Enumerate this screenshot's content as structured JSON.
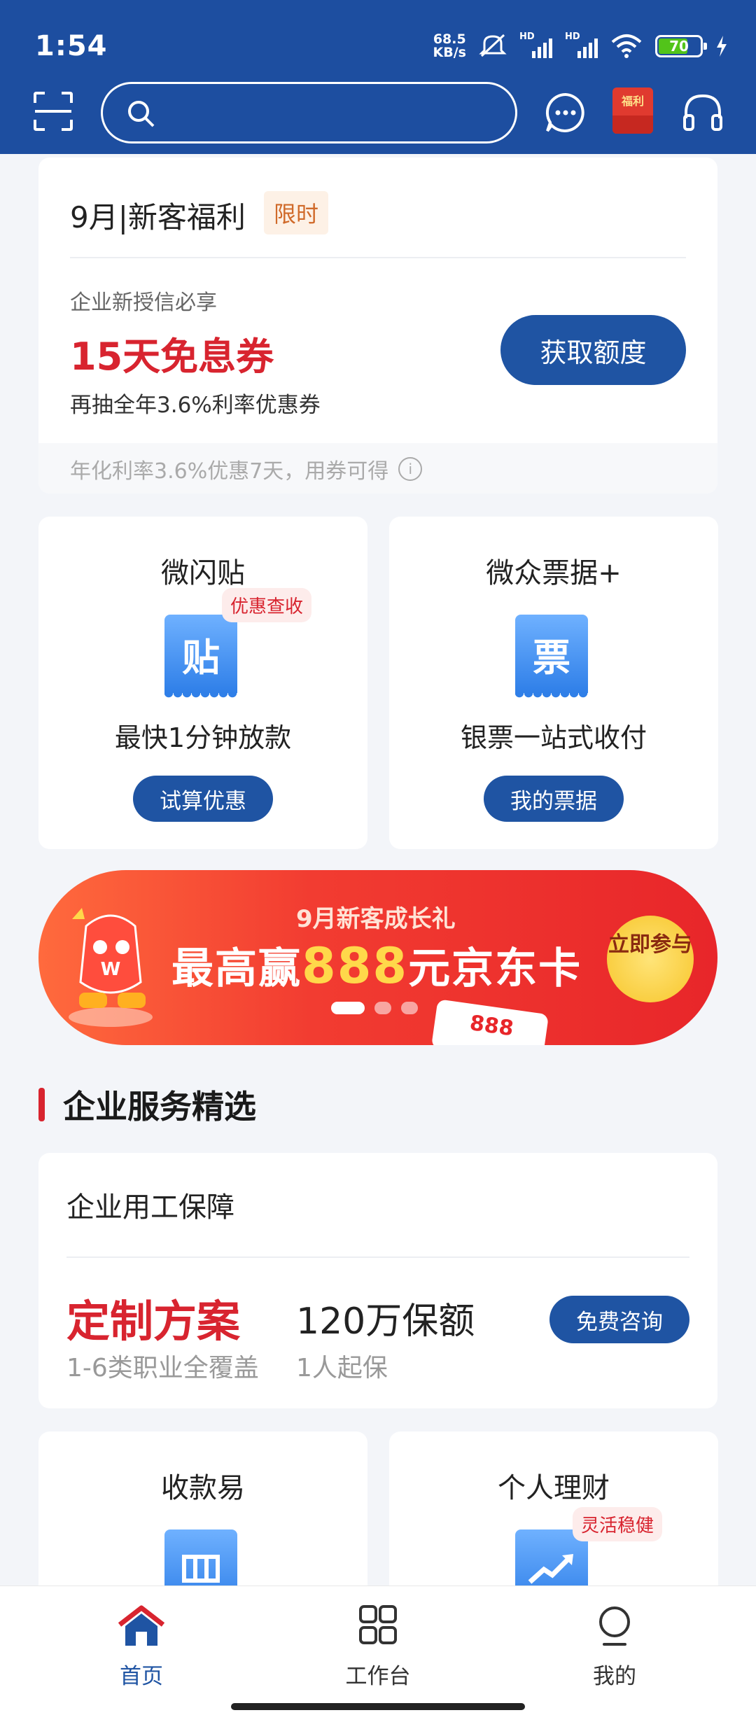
{
  "status": {
    "time": "1:54",
    "net_speed_value": "68.5",
    "net_speed_unit": "KB/s",
    "battery": "70",
    "signal_hd": "HD"
  },
  "colors": {
    "header": "#1d4ea0",
    "primary_button": "#1f54a3",
    "accent_red": "#d8242f",
    "background": "#f3f5f9"
  },
  "header": {
    "search_placeholder": "",
    "gift_label": "福利",
    "icons": [
      "scan-icon",
      "search-icon",
      "message-icon",
      "gift-envelope-icon",
      "headset-icon"
    ]
  },
  "welfare": {
    "title": "9月|新客福利",
    "tag": "限时",
    "subtitle": "企业新授信必享",
    "highlight": "15天免息券",
    "description": "再抽全年3.6%利率优惠券",
    "button": "获取额度",
    "footer": "年化利率3.6%优惠7天，用券可得"
  },
  "products_row1": [
    {
      "title": "微闪贴",
      "icon_glyph": "贴",
      "badge": "优惠查收",
      "description": "最快1分钟放款",
      "button": "试算优惠"
    },
    {
      "title": "微众票据+",
      "icon_glyph": "票",
      "badge": "",
      "description": "银票一站式收付",
      "button": "我的票据"
    }
  ],
  "banner": {
    "subtitle": "9月新客成长礼",
    "main_prefix": "最高赢",
    "main_highlight": "888",
    "main_suffix": "元京东卡",
    "cta": "立即参与",
    "card_text": "888",
    "active_slide": 1,
    "total_slides": 3
  },
  "section": {
    "title": "企业服务精选"
  },
  "employment": {
    "title": "企业用工保障",
    "highlight": "定制方案",
    "highlight_sub": "1-6类职业全覆盖",
    "amount": "120万保额",
    "amount_sub": "1人起保",
    "button": "免费咨询"
  },
  "products_row2": [
    {
      "title": "收款易",
      "badge": ""
    },
    {
      "title": "个人理财",
      "badge": "灵活稳健"
    }
  ],
  "tabbar": [
    {
      "label": "首页",
      "icon": "home-icon",
      "active": true
    },
    {
      "label": "工作台",
      "icon": "grid-icon",
      "active": false
    },
    {
      "label": "我的",
      "icon": "user-icon",
      "active": false
    }
  ]
}
